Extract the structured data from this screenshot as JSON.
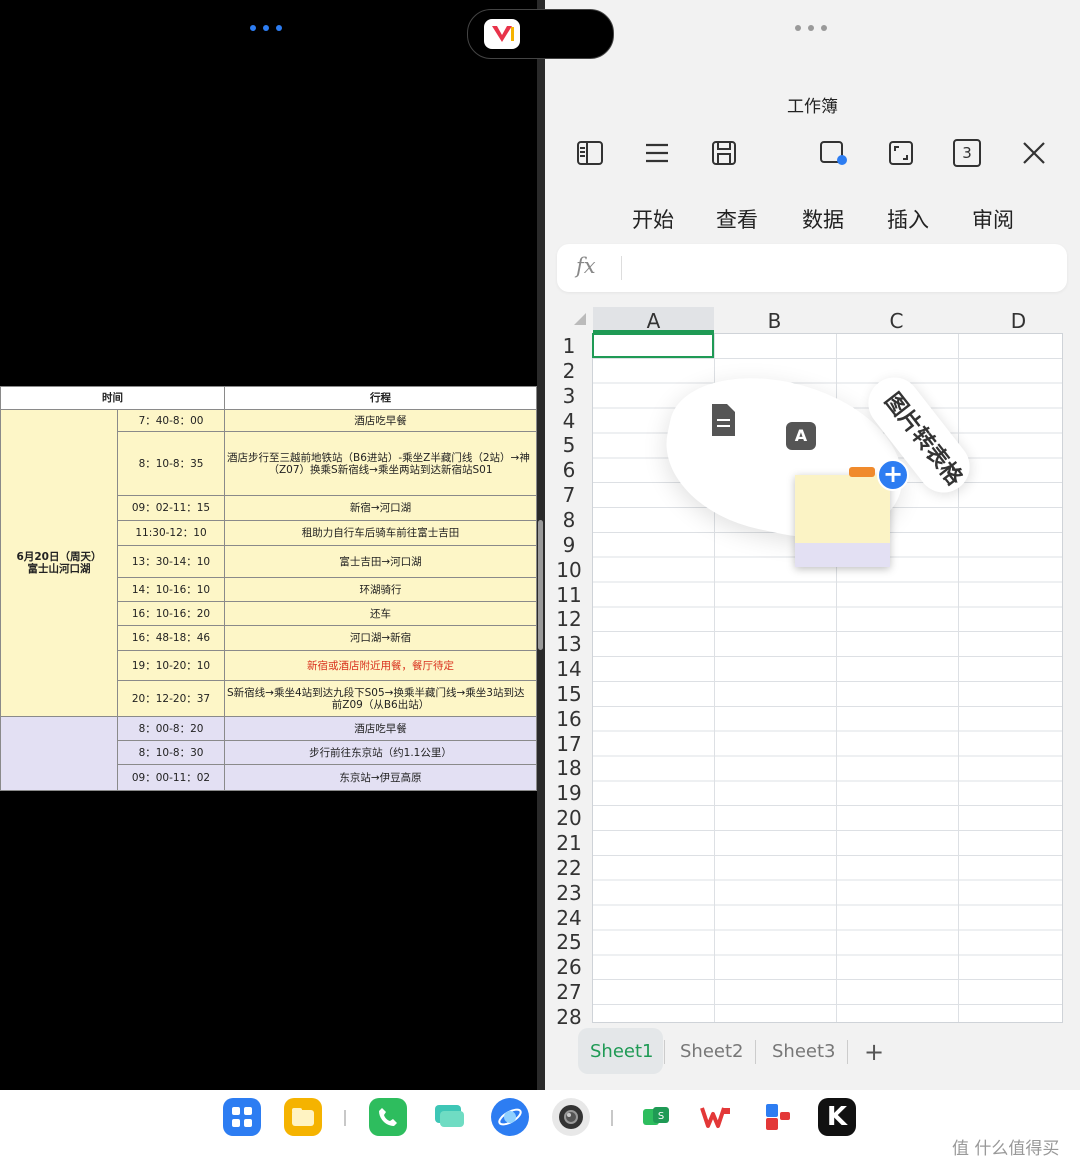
{
  "left_app": {
    "more_menu": "•••",
    "table": {
      "headers": [
        "时间",
        "行程"
      ],
      "date_cell": [
        "6月20日（周天）",
        "富士山河口湖"
      ],
      "rows": [
        {
          "time": "7：40-8：00",
          "plan": "酒店吃早餐"
        },
        {
          "time": "8：10-8：35",
          "plan": "酒店步行至三越前地铁站（B6进站）-乘坐Z半藏门线（2站）→神",
          "plan2": "（Z07）换乘S新宿线→乘坐两站到达新宿站S01"
        },
        {
          "time": "09：02-11：15",
          "plan": "新宿→河口湖"
        },
        {
          "time": "11:30-12：10",
          "plan": "租助力自行车后骑车前往富士吉田"
        },
        {
          "time": "13：30-14：10",
          "plan": "富士吉田→河口湖"
        },
        {
          "time": "14：10-16：10",
          "plan": "环湖骑行"
        },
        {
          "time": "16：10-16：20",
          "plan": "还车"
        },
        {
          "time": "16：48-18：46",
          "plan": "河口湖→新宿"
        },
        {
          "time": "19：10-20：10",
          "plan": "新宿或酒店附近用餐，餐厅待定"
        },
        {
          "time": "20：12-20：37",
          "plan": "S新宿线→乘坐4站到达九段下S05→换乘半藏门线→乘坐3站到达",
          "plan2": "前Z09（从B6出站）"
        }
      ],
      "rows_next_day": [
        {
          "time": "8：00-8：20",
          "plan": "酒店吃早餐"
        },
        {
          "time": "8：10-8：30",
          "plan": "步行前往东京站（约1.1公里）"
        },
        {
          "time": "09：00-11：02",
          "plan": "东京站→伊豆高原"
        }
      ]
    }
  },
  "right_app": {
    "more_menu": "•••",
    "title": "工作簿",
    "toolbar": {
      "icons": [
        "sidebar-toggle-icon",
        "menu-icon",
        "save-icon",
        "mirror-screen-icon",
        "fullscreen-icon",
        "tab-count-icon",
        "close-icon"
      ],
      "tab_count": "3"
    },
    "menu_tabs": [
      "开始",
      "查看",
      "数据",
      "插入",
      "审阅"
    ],
    "formula_bar": {
      "fx_label": "fx",
      "value": ""
    },
    "columns": [
      "A",
      "B",
      "C",
      "D"
    ],
    "rows": [
      "1",
      "2",
      "3",
      "4",
      "5",
      "6",
      "7",
      "8",
      "9",
      "10",
      "11",
      "12",
      "13",
      "14",
      "15",
      "16",
      "17",
      "18",
      "19",
      "20",
      "21",
      "22",
      "23",
      "24",
      "25",
      "26",
      "27",
      "28"
    ],
    "selected_cell": "A1",
    "floating_tool": {
      "label": "图片转表格",
      "icons": [
        "document-icon",
        "text-recognition-icon",
        "add-icon"
      ]
    },
    "sheets": [
      "Sheet1",
      "Sheet2",
      "Sheet3"
    ],
    "add_sheet": "+",
    "active_sheet": "Sheet1"
  },
  "dock": {
    "apps": [
      "app-launcher-icon",
      "files-icon",
      "phone-icon",
      "messages-icon",
      "browser-icon",
      "camera-icon",
      "sheets-app-icon",
      "wps-icon",
      "dual-app-icon",
      "k-app-icon"
    ]
  },
  "watermark": "值 什么值得买",
  "colors": {
    "accent_green": "#1f9a55",
    "yellow_row": "#fdf6c7",
    "purple_row": "#e3e0f3",
    "red_text": "#d9301c"
  }
}
